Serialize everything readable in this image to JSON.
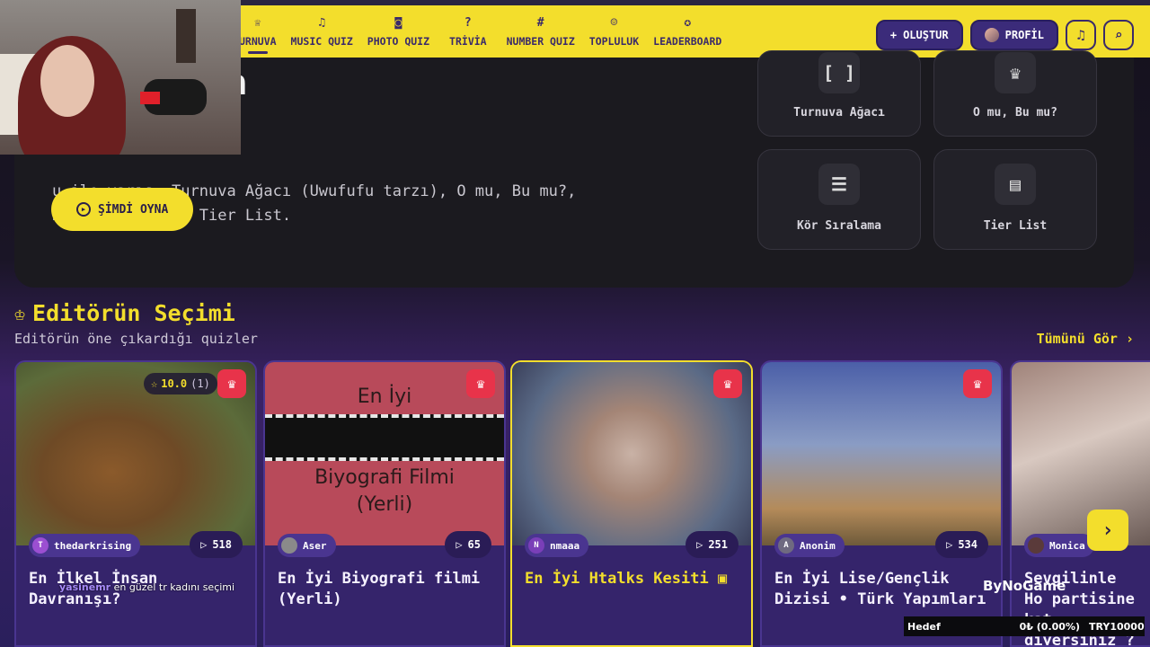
{
  "nav": {
    "items": [
      {
        "label": "URNUVA",
        "icon": "trophy-icon",
        "glyph": "♕",
        "active": true
      },
      {
        "label": "MUSIC QUIZ",
        "icon": "music-icon",
        "glyph": "♫"
      },
      {
        "label": "PHOTO QUIZ",
        "icon": "camera-icon",
        "glyph": "◙"
      },
      {
        "label": "TRİVİA",
        "icon": "question-icon",
        "glyph": "?"
      },
      {
        "label": "NUMBER QUIZ",
        "icon": "hash-icon",
        "glyph": "#"
      },
      {
        "label": "TOPLULUK",
        "icon": "users-icon",
        "glyph": "☺"
      },
      {
        "label": "LEADERBOARD",
        "icon": "medal-icon",
        "glyph": "✪"
      }
    ],
    "create_label": "OLUŞTUR",
    "profile_label": "PROFİL"
  },
  "hero": {
    "title_fragment": "a",
    "description": "u ile yarış: Turnuva Ağacı (Uwufufu tarzı), O mu, Bu mu?, Kör Sıralama ve Tier List.",
    "play_label": "ŞİMDİ OYNA",
    "modes": [
      {
        "label": "Turnuva Ağacı",
        "icon": "bracket-icon",
        "glyph": "[ ]"
      },
      {
        "label": "O mu, Bu mu?",
        "icon": "crown-icon",
        "glyph": "♛"
      },
      {
        "label": "Kör Sıralama",
        "icon": "ordered-list-icon",
        "glyph": "☰"
      },
      {
        "label": "Tier List",
        "icon": "tier-list-icon",
        "glyph": "▤"
      }
    ]
  },
  "section": {
    "title": "Editörün Seçimi",
    "subtitle": "Editörün öne çıkardığı quizler",
    "see_all": "Tümünü Gör ›"
  },
  "cards": [
    {
      "title": "En İlkel İnsan Davranışı?",
      "author": "thedarkrising",
      "author_initial": "T",
      "plays": "518",
      "rating": "10.0",
      "rating_count": "(1)"
    },
    {
      "title": "En İyi Biyografi filmi (Yerli)",
      "author": "Aser",
      "author_initial": "",
      "plays": "65",
      "thumb_top": "En İyi",
      "thumb_bottom_1": "Biyografi Filmi",
      "thumb_bottom_2": "(Yerli)"
    },
    {
      "title": "En İyi Htalks Kesiti",
      "author": "nmaaa",
      "author_initial": "N",
      "plays": "251"
    },
    {
      "title": "En İyi Lise/Gençlik Dizisi • Türk Yapımları",
      "author": "Anonim",
      "author_initial": "A",
      "plays": "534"
    },
    {
      "title": "Sevgilinle Ho partisine kat giyersiniz ?",
      "author": "Monica",
      "author_initial": ""
    }
  ],
  "overlay": {
    "chat_user": "yasinemr",
    "chat_text": "en güzel tr kadını seçimi",
    "brand": "ByNoGame",
    "goal_label": "Hedef",
    "goal_progress": "0₺ (0.00%)",
    "goal_target": "TRY10000"
  },
  "colors": {
    "accent": "#f3de2c",
    "card_bg": "#35246b",
    "badge": "#e8334a",
    "panel": "#1b1a1f"
  }
}
